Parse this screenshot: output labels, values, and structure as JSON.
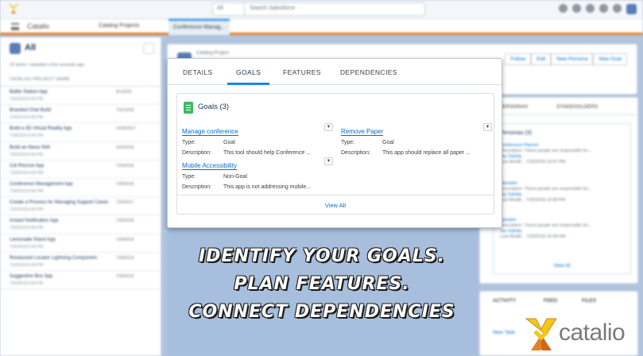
{
  "header": {
    "search_scope": "All",
    "search_placeholder": "Search Salesforce"
  },
  "nav": {
    "app_name": "Catalio",
    "tabs": [
      {
        "label": "Catalog Projects"
      },
      {
        "label": "Conference Manag..."
      }
    ]
  },
  "list_view": {
    "title": "All",
    "meta": "22 items • Updated a few seconds ago",
    "column": "CATALOG PROJECT NAME",
    "rows": [
      {
        "name": "Battle Station App",
        "date": "8/1/2018",
        "sub": "7/30/2018 8:40 PM"
      },
      {
        "name": "Branded Chat Build",
        "date": "7/31/2018",
        "sub": "7/30/2018 8:40 PM"
      },
      {
        "name": "Build a 3D Virtual Reality App",
        "date": "10/26/2017",
        "sub": "7/30/2018 8:40 PM"
      },
      {
        "name": "Build an Alexa Skill",
        "date": "5/25/2018",
        "sub": "7/30/2018 8:40 PM"
      },
      {
        "name": "Cat Rescue App",
        "date": "7/28/2018",
        "sub": "7/30/2018 8:40 PM"
      },
      {
        "name": "Conference Management App",
        "date": "7/28/2018",
        "sub": "7/30/2018 8:40 PM"
      },
      {
        "name": "Create a Process for Managing Support Cases",
        "date": "7/30/2017",
        "sub": "7/30/2018 8:40 PM"
      },
      {
        "name": "Instant Notification App",
        "date": "7/28/2018",
        "sub": "7/30/2018 8:40 PM"
      },
      {
        "name": "Lemonade Stand App",
        "date": "7/28/2018",
        "sub": "7/30/2018 8:40 PM"
      },
      {
        "name": "Restaurant Locator Lightning Component",
        "date": "7/28/2018",
        "sub": "7/30/2018 8:40 PM"
      },
      {
        "name": "Suggestion Box App",
        "date": "7/28/2018",
        "sub": "7/30/2018 8:40 PM"
      }
    ]
  },
  "record": {
    "object_label": "Catalog Project",
    "actions": [
      "Follow",
      "Edit",
      "New Persona",
      "New Goal"
    ]
  },
  "side_panel": {
    "tabs": [
      "PERSONAS",
      "STAKEHOLDERS"
    ],
    "personas_title": "Personas (3)",
    "personas": [
      {
        "name": "Conference Planner",
        "desc": "These people are responsible for...",
        "owner": "Jay Gatsby",
        "date": "7/29/2018 10:07 PM"
      },
      {
        "name": "Attendee",
        "desc": "These people are responsible for...",
        "owner": "Jay Gatsby",
        "date": "7/29/2018 10:08 PM"
      },
      {
        "name": "Speaker",
        "desc": "These people are responsible for...",
        "owner": "Jay Gatsby",
        "date": "7/29/2018 10:08 PM"
      }
    ],
    "field_desc": "Description:",
    "field_mod": "Last Modifi...",
    "view_all": "View All"
  },
  "activity": {
    "tabs": [
      "ACTIVITY",
      "FEED",
      "FILES"
    ],
    "new_task": "New Task"
  },
  "card": {
    "tabs": [
      {
        "label": "DETAILS",
        "active": false
      },
      {
        "label": "GOALS",
        "active": true
      },
      {
        "label": "FEATURES",
        "active": false
      },
      {
        "label": "DEPENDENCIES",
        "active": false
      }
    ],
    "goals_title": "Goals (3)",
    "type_label": "Type:",
    "desc_label": "Description:",
    "goals": [
      {
        "name": "Manage conference",
        "type": "Goal",
        "description": "This tool should help Conference ..."
      },
      {
        "name": "Remove Paper",
        "type": "Goal",
        "description": "This app should replace all paper ..."
      },
      {
        "name": "Mobile Accessibility",
        "type": "Non-Goal",
        "description": "This app is not addressing mobile..."
      }
    ],
    "view_all": "View All"
  },
  "slogan": {
    "line1": "IDENTIFY YOUR GOALS.",
    "line2": "PLAN FEATURES.",
    "line3": "CONNECT DEPENDENCIES"
  },
  "brand": {
    "name": "catalio",
    "colors": {
      "orange": "#e4802a",
      "yellow": "#f5c518",
      "gray": "#7a7a7a"
    }
  }
}
